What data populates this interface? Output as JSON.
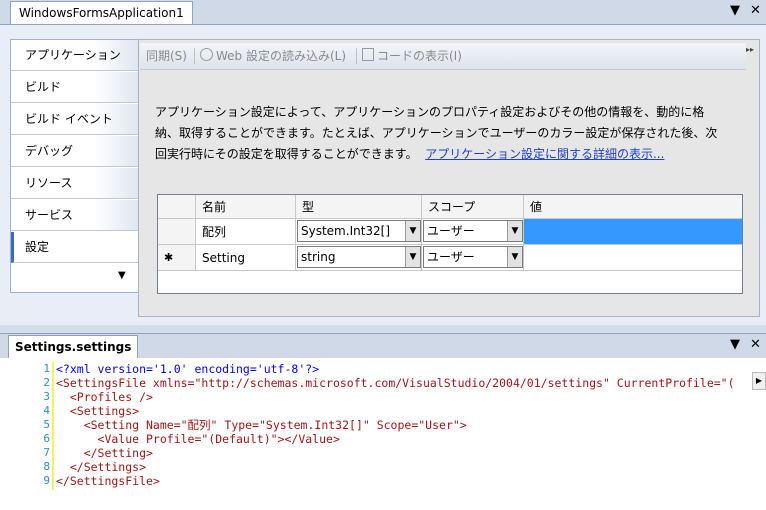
{
  "top_tab": {
    "title": "WindowsFormsApplication1"
  },
  "window_controls": {
    "dropdown": "▼",
    "close": "✕"
  },
  "nav": {
    "items": [
      {
        "label": "アプリケーション"
      },
      {
        "label": "ビルド"
      },
      {
        "label": "ビルド イベント"
      },
      {
        "label": "デバッグ"
      },
      {
        "label": "リソース"
      },
      {
        "label": "サービス"
      },
      {
        "label": "設定"
      }
    ],
    "active_index": 6,
    "scroll_glyph": "▼"
  },
  "toolbar": {
    "sync": "同期(S)",
    "load_web": "Web 設定の読み込み(L)",
    "view_code": "コードの表示(I)",
    "overflow": "▸▸"
  },
  "description": {
    "line1": "アプリケーション設定によって、アプリケーションのプロパティ設定およびその他の情報を、動的に格",
    "line2": "納、取得することができます。たとえば、アプリケーションでユーザーのカラー設定が保存された後、次",
    "line3": "回実行時にその設定を取得することができます。",
    "link": "アプリケーション設定に関する詳細の表示..."
  },
  "grid": {
    "headers": [
      "名前",
      "型",
      "スコープ",
      "値"
    ],
    "rows": [
      {
        "marker": "",
        "name": "配列",
        "type": "System.Int32[]",
        "scope": "ユーザー",
        "value": ""
      },
      {
        "marker": "✱",
        "name": "Setting",
        "type": "string",
        "scope": "ユーザー",
        "value": ""
      }
    ]
  },
  "code_tab": {
    "title": "Settings.settings"
  },
  "editor": {
    "line_numbers": [
      "1",
      "2",
      "3",
      "4",
      "5",
      "6",
      "7",
      "8",
      "9"
    ],
    "lines": [
      "<?xml version='1.0' encoding='utf-8'?>",
      "<SettingsFile xmlns=\"http://schemas.microsoft.com/VisualStudio/2004/01/settings\" CurrentProfile=\"(",
      "  <Profiles />",
      "  <Settings>",
      "    <Setting Name=\"配列\" Type=\"System.Int32[]\" Scope=\"User\">",
      "      <Value Profile=\"(Default)\"></Value>",
      "    </Setting>",
      "  </Settings>",
      "</SettingsFile>"
    ]
  },
  "colors": {
    "selection": "#3399ff",
    "link": "#1f3fcf",
    "xml_tag": "#a31515",
    "xml_attr": "#ff0000",
    "xml_punct": "#0000ff"
  }
}
